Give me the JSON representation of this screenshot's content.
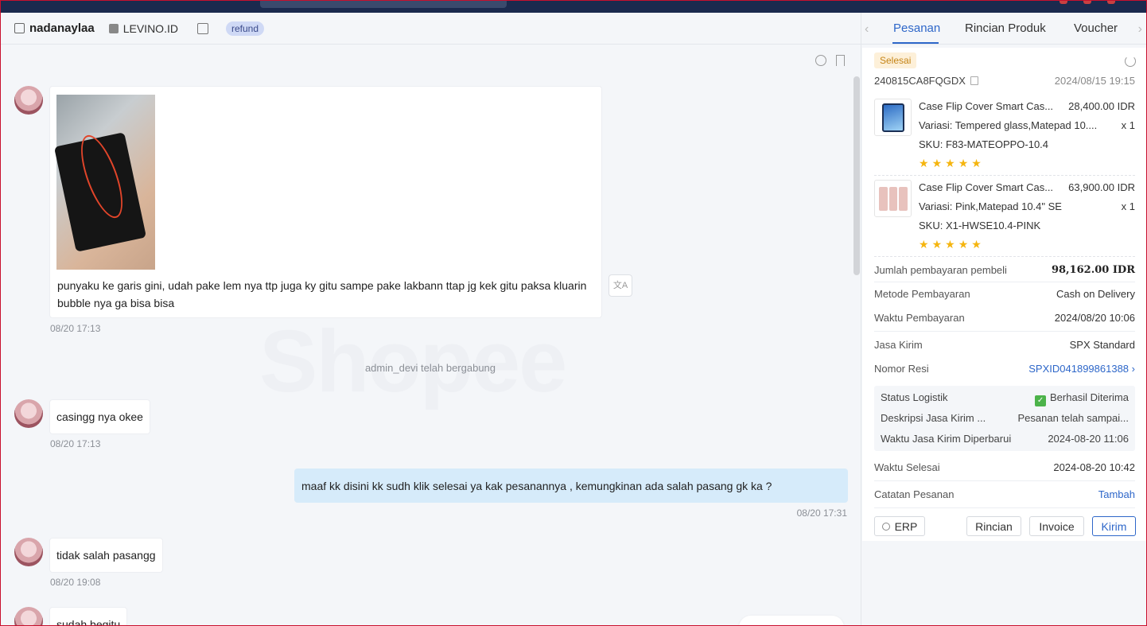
{
  "header": {
    "username": "nadanaylaa",
    "shop": "LEVINO.ID",
    "tag": "refund"
  },
  "watermark": "Shopee",
  "messages": [
    {
      "text": "punyaku ke garis gini, udah pake lem nya ttp juga ky gitu sampe pake lakbann ttap jg kek gitu paksa kluarin bubble nya ga bisa bisa",
      "time": "08/20 17:13"
    },
    {
      "text": "casingg nya okee",
      "time": "08/20 17:13"
    },
    {
      "text": "maaf kk disini kk sudh klik selesai ya kak  pesanannya , kemungkinan ada salah pasang gk ka ?",
      "time": "08/20 17:31"
    },
    {
      "text": "tidak salah pasangg",
      "time": "08/20 19:08"
    },
    {
      "text": "sudah begitu"
    }
  ],
  "system_msg": "admin_devi telah bergabung",
  "translate_label": "文A",
  "panel": {
    "tabs": [
      "Pesanan",
      "Rincian Produk",
      "Voucher"
    ],
    "status": "Selesai",
    "order_id": "240815CA8FQGDX",
    "order_date": "2024/08/15 19:15",
    "products": [
      {
        "name": "Case Flip Cover Smart Cas...",
        "price": "28,400.00 IDR",
        "variant": "Variasi:  Tempered glass,Matepad 10....",
        "qty": "x 1",
        "sku": "SKU:  F83-MATEOPPO-10.4",
        "rating": 5
      },
      {
        "name": "Case Flip Cover Smart Cas...",
        "price": "63,900.00 IDR",
        "variant": "Variasi:  Pink,Matepad 10.4\" SE",
        "qty": "x 1",
        "sku": "SKU:  X1-HWSE10.4-PINK",
        "rating": 5
      }
    ],
    "details": {
      "total_label": "Jumlah pembayaran pembeli",
      "total_value": "98,162.00 IDR",
      "payment_method_label": "Metode Pembayaran",
      "payment_method_value": "Cash on Delivery",
      "payment_time_label": "Waktu Pembayaran",
      "payment_time_value": "2024/08/20 10:06",
      "courier_label": "Jasa Kirim",
      "courier_value": "SPX Standard",
      "resi_label": "Nomor Resi",
      "resi_value": "SPXID041899861388",
      "logistic_status_label": "Status Logistik",
      "logistic_status_value": "Berhasil Diterima",
      "courier_desc_label": "Deskripsi Jasa Kirim ...",
      "courier_desc_value": "Pesanan telah sampai...",
      "courier_updated_label": "Waktu Jasa Kirim Diperbarui",
      "courier_updated_value": "2024-08-20 11:06",
      "finished_label": "Waktu Selesai",
      "finished_value": "2024-08-20 10:42",
      "note_label": "Catatan Pesanan",
      "note_action": "Tambah"
    },
    "buttons": {
      "erp": "ERP",
      "rincian": "Rincian",
      "invoice": "Invoice",
      "kirim": "Kirim"
    }
  },
  "colors": {
    "accent": "#2e67c9",
    "star": "#f5b50f",
    "status_bg": "#fdf0d9",
    "outgoing_bubble": "#d6ebfa"
  }
}
